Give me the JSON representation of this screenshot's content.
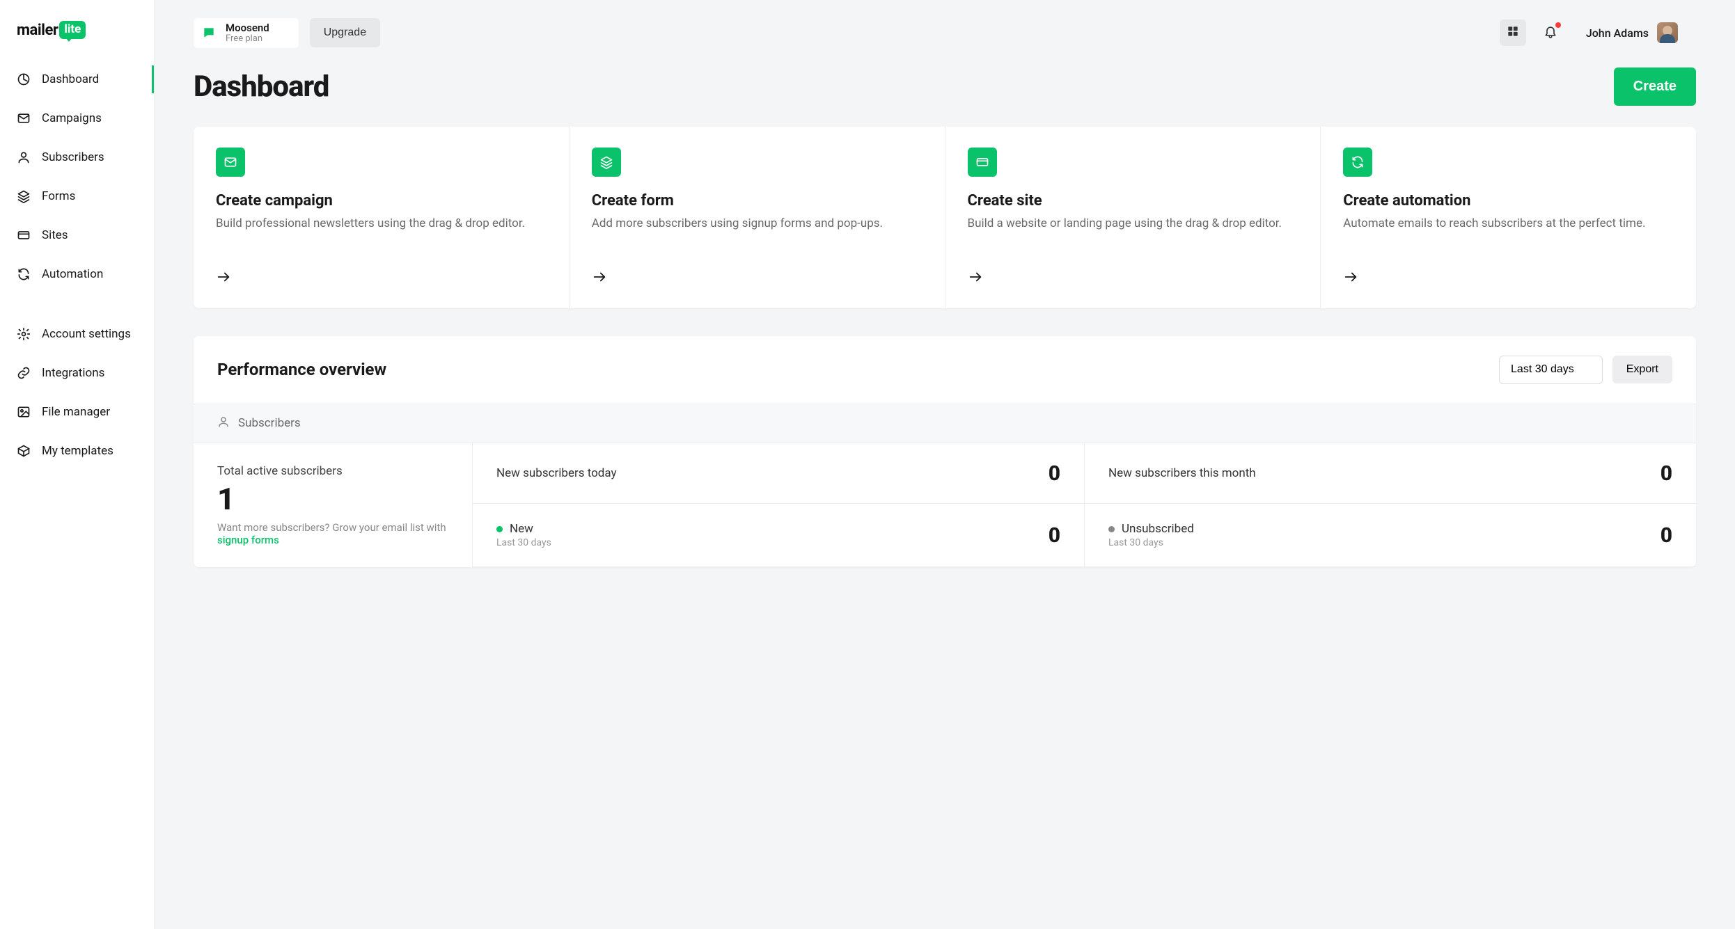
{
  "brand": {
    "name": "mailer",
    "badge": "lite"
  },
  "sidebar": {
    "items": [
      {
        "label": "Dashboard",
        "icon": "dashboard",
        "name": "dashboard"
      },
      {
        "label": "Campaigns",
        "icon": "mail",
        "name": "campaigns"
      },
      {
        "label": "Subscribers",
        "icon": "user",
        "name": "subscribers"
      },
      {
        "label": "Forms",
        "icon": "layers",
        "name": "forms"
      },
      {
        "label": "Sites",
        "icon": "card",
        "name": "sites"
      },
      {
        "label": "Automation",
        "icon": "refresh",
        "name": "automation"
      }
    ],
    "items2": [
      {
        "label": "Account settings",
        "icon": "gear",
        "name": "account-settings"
      },
      {
        "label": "Integrations",
        "icon": "link",
        "name": "integrations"
      },
      {
        "label": "File manager",
        "icon": "image",
        "name": "file-manager"
      },
      {
        "label": "My templates",
        "icon": "box",
        "name": "my-templates"
      }
    ],
    "active": 0
  },
  "header": {
    "workspace": {
      "name": "Moosend",
      "plan": "Free plan"
    },
    "upgrade_label": "Upgrade",
    "user_name": "John Adams"
  },
  "page": {
    "title": "Dashboard",
    "create_label": "Create"
  },
  "cards": [
    {
      "title": "Create campaign",
      "desc": "Build professional newsletters using the drag & drop editor.",
      "icon": "mail",
      "name": "campaign"
    },
    {
      "title": "Create form",
      "desc": "Add more subscribers using signup forms and pop-ups.",
      "icon": "layers",
      "name": "form"
    },
    {
      "title": "Create site",
      "desc": "Build a website or landing page using the drag & drop editor.",
      "icon": "card",
      "name": "site"
    },
    {
      "title": "Create automation",
      "desc": "Automate emails to reach subscribers at the perfect time.",
      "icon": "refresh",
      "name": "automation"
    }
  ],
  "performance": {
    "title": "Performance overview",
    "range_label": "Last 30 days",
    "export_label": "Export",
    "section_label": "Subscribers",
    "total_label": "Total active subscribers",
    "total_value": "1",
    "hint_prefix": "Want more subscribers? ",
    "hint_text": "Grow your email list with ",
    "hint_link": "signup forms",
    "stats": [
      {
        "label": "New subscribers today",
        "value": "0",
        "dot": "",
        "sub": ""
      },
      {
        "label": "New subscribers this month",
        "value": "0",
        "dot": "",
        "sub": ""
      },
      {
        "label": "New",
        "value": "0",
        "dot": "green",
        "sub": "Last 30 days"
      },
      {
        "label": "Unsubscribed",
        "value": "0",
        "dot": "grey",
        "sub": "Last 30 days"
      }
    ]
  }
}
